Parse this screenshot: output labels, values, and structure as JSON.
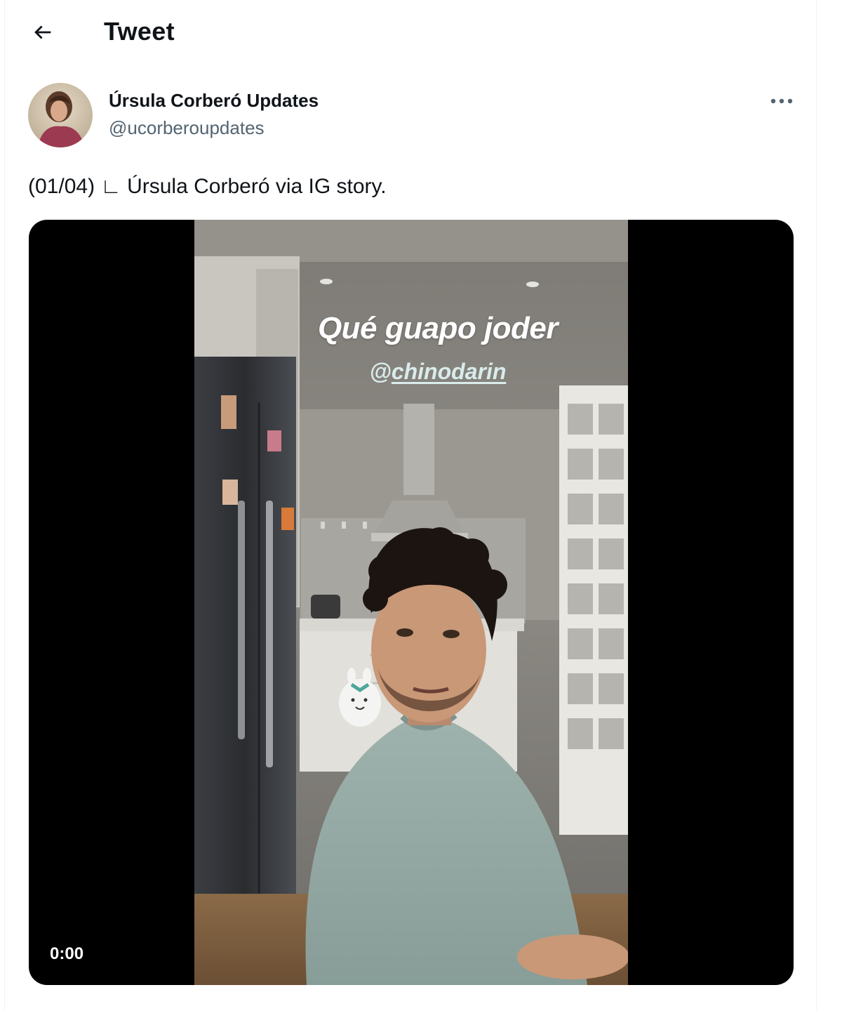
{
  "header": {
    "title": "Tweet",
    "back_icon": "arrow-left-icon"
  },
  "tweet": {
    "author": {
      "display_name": "Úrsula Corberó Updates",
      "handle": "@ucorberoupdates"
    },
    "more_icon": "ellipsis-icon",
    "text": "(01/04) ∟ Úrsula Corberó via IG story.",
    "media": {
      "type": "video",
      "story_title": "Qué guapo joder",
      "story_mention_at": "@",
      "story_mention_name": "chinodarin",
      "time": "0:00"
    }
  },
  "colors": {
    "text_primary": "#0f1419",
    "text_secondary": "#536471",
    "media_background": "#000000"
  }
}
